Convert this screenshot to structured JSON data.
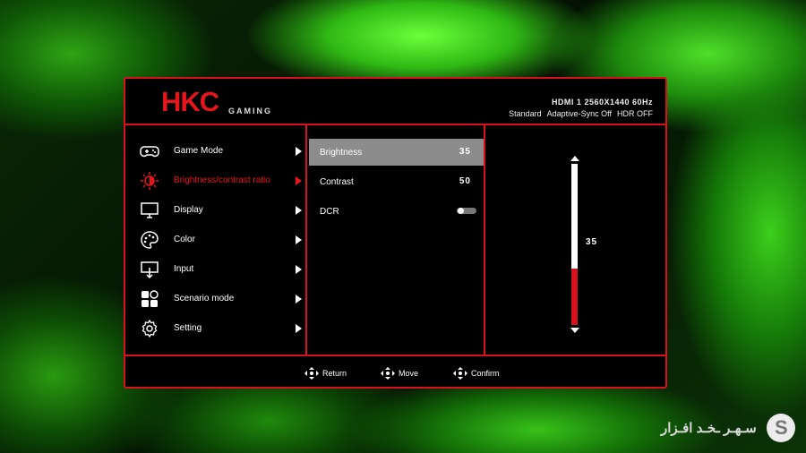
{
  "header": {
    "logo": "HKC",
    "logo_sub": "GAMING",
    "input_info": "HDMI 1 2560X1440 60Hz",
    "status": {
      "mode": "Standard",
      "adaptive_sync": "Adaptive-Sync Off",
      "hdr": "HDR OFF"
    }
  },
  "menu": {
    "items": [
      {
        "label": "Game Mode",
        "icon": "gamepad-icon"
      },
      {
        "label": "Brightness/contrast ratio",
        "icon": "brightness-icon",
        "active": true
      },
      {
        "label": "Display",
        "icon": "monitor-icon"
      },
      {
        "label": "Color",
        "icon": "palette-icon"
      },
      {
        "label": "Input",
        "icon": "input-icon"
      },
      {
        "label": "Scenario mode",
        "icon": "grid-icon"
      },
      {
        "label": "Setting",
        "icon": "gear-icon"
      }
    ]
  },
  "submenu": {
    "items": [
      {
        "label": "Brightness",
        "value": "35",
        "selected": true
      },
      {
        "label": "Contrast",
        "value": "50"
      },
      {
        "label": "DCR",
        "toggle": "off"
      }
    ]
  },
  "slider": {
    "value": "35",
    "fraction": 0.35
  },
  "footer": {
    "return_label": "Return",
    "move_label": "Move",
    "confirm_label": "Confirm"
  },
  "watermark": {
    "text": "سـهـر ـخـد افـزار",
    "logo_letter": "S"
  },
  "colors": {
    "accent": "#d8121c",
    "panel": "#000000",
    "selected": "#8c8c8c"
  }
}
